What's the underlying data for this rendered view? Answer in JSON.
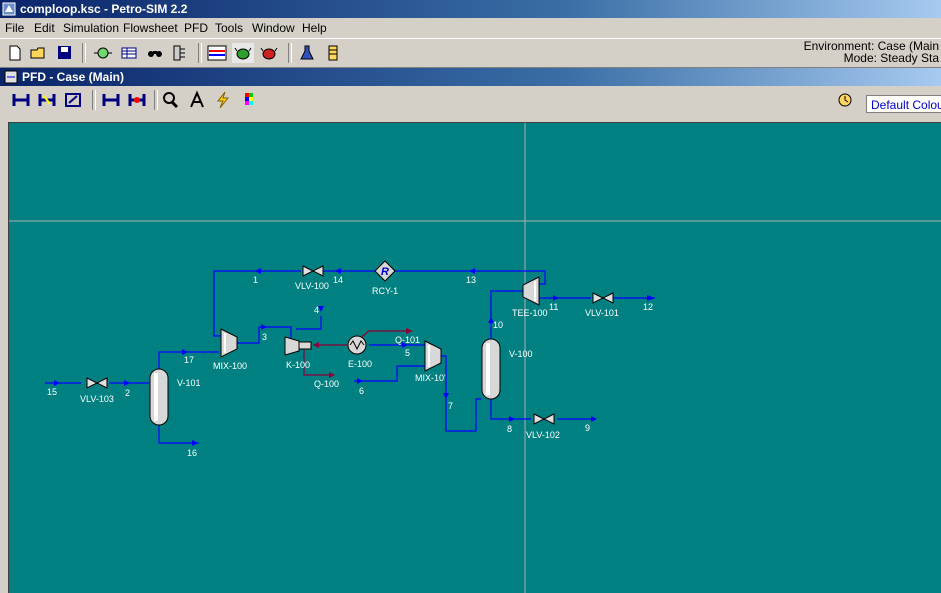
{
  "window": {
    "title": "comploop.ksc - Petro-SIM 2.2"
  },
  "menu": [
    "File",
    "Edit",
    "Simulation",
    "Flowsheet",
    "PFD",
    "Tools",
    "Window",
    "Help"
  ],
  "environment": {
    "line1": "Environment: Case (Main",
    "line2": "Mode: Steady Sta"
  },
  "pfd_window": {
    "title": "PFD - Case (Main)"
  },
  "colour_scheme": {
    "selected": "Default Colour"
  },
  "toolbar_icons": [
    "new-icon",
    "open-icon",
    "save-icon",
    "simulation-basis-icon",
    "workbook-icon",
    "find-icon",
    "object-navigator-icon",
    "pfd-icon",
    "solver-active-icon",
    "solver-hold-icon",
    "flask-icon",
    "column-icon"
  ],
  "pfd_toolbar_icons": [
    "size-mode-icon",
    "zoom-in-icon",
    "zoom-fit-icon",
    "attach-mode-icon",
    "auto-position-icon",
    "zoom-glass-icon",
    "text-annotation-icon",
    "lightning-icon",
    "palette-icon"
  ],
  "colors": {
    "canvas": "#008080",
    "stream": "#0000ff",
    "energy": "#8b0038",
    "title": "#0a246a"
  },
  "pfd": {
    "units": {
      "vlv103": "VLV-103",
      "v101": "V-101",
      "mix100": "MIX-100",
      "k100": "K-100",
      "e100": "E-100",
      "mix101": "MIX-10'",
      "v100": "V-100",
      "tee100": "TEE-100",
      "vlv100": "VLV-100",
      "vlv101": "VLV-101",
      "vlv102": "VLV-102",
      "rcy1": "RCY-1",
      "q100": "Q-100",
      "q101": "Q-101"
    },
    "streams": {
      "s15": "15",
      "s2": "2",
      "s16": "16",
      "s17": "17",
      "s3": "3",
      "s4": "4",
      "s5": "5",
      "s6": "6",
      "s7": "7",
      "s8": "8",
      "s9": "9",
      "s10": "10",
      "s11": "11",
      "s12": "12",
      "s13": "13",
      "s14": "14",
      "s1": "1"
    },
    "recycle_symbol": "R"
  }
}
